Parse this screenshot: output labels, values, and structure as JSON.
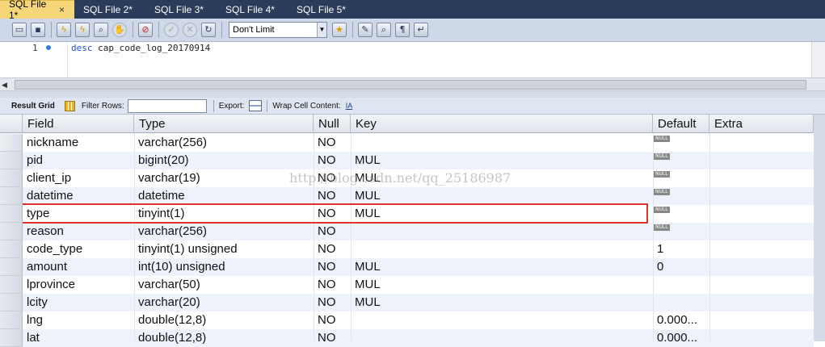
{
  "tabs": [
    {
      "label": "SQL File 1*",
      "active": true
    },
    {
      "label": "SQL File 2*",
      "active": false
    },
    {
      "label": "SQL File 3*",
      "active": false
    },
    {
      "label": "SQL File 4*",
      "active": false
    },
    {
      "label": "SQL File 5*",
      "active": false
    }
  ],
  "tab_close_glyph": "×",
  "toolbar": {
    "limit_value": "Don't Limit",
    "icons": [
      "open-folder-icon",
      "save-icon",
      "execute-icon",
      "execute-current-icon",
      "explain-icon",
      "stop-icon",
      "toggle-stop-on-error-icon",
      "commit-icon",
      "rollback-icon",
      "autocommit-icon",
      "add-snippet-icon",
      "beautify-icon",
      "find-icon",
      "invisible-chars-icon",
      "wrap-lines-icon"
    ]
  },
  "editor": {
    "line_number": "1",
    "keyword": "desc",
    "code_rest": " cap_code_log_20170914"
  },
  "result_toolbar": {
    "result_grid_label": "Result Grid",
    "filter_rows_label": "Filter Rows:",
    "filter_value": "",
    "export_label": "Export:",
    "wrap_label": "Wrap Cell Content:",
    "wrap_icon_glyph": "IA"
  },
  "grid": {
    "columns": [
      "Field",
      "Type",
      "Null",
      "Key",
      "Default",
      "Extra"
    ],
    "null_text": "NULL",
    "rows": [
      {
        "field": "nickname",
        "type": "varchar(256)",
        "null": "NO",
        "key": "",
        "default": "",
        "default_null": true,
        "extra": ""
      },
      {
        "field": "pid",
        "type": "bigint(20)",
        "null": "NO",
        "key": "MUL",
        "default": "",
        "default_null": true,
        "extra": ""
      },
      {
        "field": "client_ip",
        "type": "varchar(19)",
        "null": "NO",
        "key": "MUL",
        "default": "",
        "default_null": true,
        "extra": ""
      },
      {
        "field": "datetime",
        "type": "datetime",
        "null": "NO",
        "key": "MUL",
        "default": "",
        "default_null": true,
        "extra": ""
      },
      {
        "field": "type",
        "type": "tinyint(1)",
        "null": "NO",
        "key": "MUL",
        "default": "",
        "default_null": true,
        "extra": ""
      },
      {
        "field": "reason",
        "type": "varchar(256)",
        "null": "NO",
        "key": "",
        "default": "",
        "default_null": true,
        "extra": ""
      },
      {
        "field": "code_type",
        "type": "tinyint(1) unsigned",
        "null": "NO",
        "key": "",
        "default": "1",
        "default_null": false,
        "extra": ""
      },
      {
        "field": "amount",
        "type": "int(10) unsigned",
        "null": "NO",
        "key": "MUL",
        "default": "0",
        "default_null": false,
        "extra": ""
      },
      {
        "field": "lprovince",
        "type": "varchar(50)",
        "null": "NO",
        "key": "MUL",
        "default": "",
        "default_null": false,
        "extra": ""
      },
      {
        "field": "lcity",
        "type": "varchar(20)",
        "null": "NO",
        "key": "MUL",
        "default": "",
        "default_null": false,
        "extra": ""
      },
      {
        "field": "lng",
        "type": "double(12,8)",
        "null": "NO",
        "key": "",
        "default": "0.000...",
        "default_null": false,
        "extra": ""
      },
      {
        "field": "lat",
        "type": "double(12,8)",
        "null": "NO",
        "key": "",
        "default": "0.000...",
        "default_null": false,
        "extra": ""
      }
    ],
    "highlighted_row": 4
  },
  "watermark": "http://blog.csdn.net/qq_25186987"
}
